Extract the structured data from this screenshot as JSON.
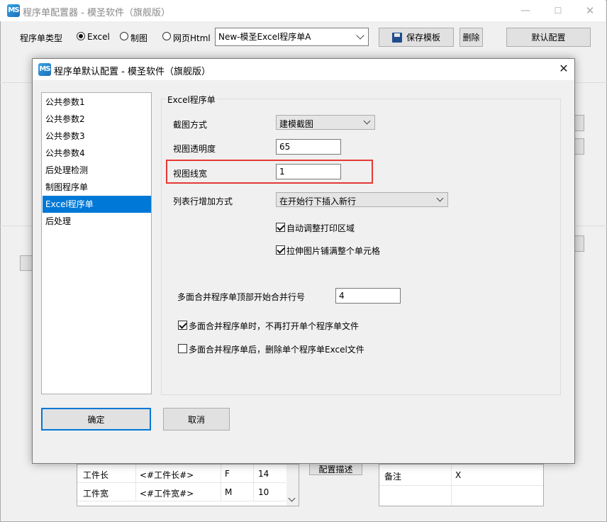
{
  "main_window": {
    "title": "程序单配置器 - 模圣软件（旗舰版）",
    "logo_text": "MS",
    "template_type_label": "程序单类型",
    "template_types": [
      {
        "label": "Excel",
        "selected": true
      },
      {
        "label": "制图",
        "selected": false
      },
      {
        "label": "网页Html",
        "selected": false
      }
    ],
    "template_select_value": "New-模圣Excel程序单A",
    "save_template_label": "保存模板",
    "delete_label": "删除",
    "default_config_label": "默认配置",
    "config_describe_label": "配置描述",
    "left_table_rows": [
      {
        "name": "工件长",
        "var": "<#工件长#>",
        "type": "F",
        "width": "14"
      },
      {
        "name": "工件宽",
        "var": "<#工件宽#>",
        "type": "M",
        "width": "10"
      }
    ],
    "right_table_rows": [
      {
        "name": "备注",
        "value": "X"
      }
    ]
  },
  "dialog": {
    "title": "程序单默认配置 - 模圣软件（旗舰版）",
    "nav_items": [
      "公共参数1",
      "公共参数2",
      "公共参数3",
      "公共参数4",
      "后处理检测",
      "制图程序单",
      "Excel程序单",
      "后处理"
    ],
    "selected_nav": "Excel程序单",
    "group_title": "Excel程序单",
    "screenshot_method_label": "截图方式",
    "screenshot_method_value": "建模截图",
    "view_transparency_label": "视图透明度",
    "view_transparency_value": "65",
    "view_linewidth_label": "视图线宽",
    "view_linewidth_value": "1",
    "list_row_add_label": "列表行增加方式",
    "list_row_add_value": "在开始行下插入新行",
    "auto_print_area_label": "自动调整打印区域",
    "auto_print_area_checked": true,
    "stretch_image_label": "拉伸图片铺满整个单元格",
    "stretch_image_checked": true,
    "merge_start_row_label": "多面合并程序单顶部开始合并行号",
    "merge_start_row_value": "4",
    "no_reopen_label": "多面合并程序单时，不再打开单个程序单文件",
    "no_reopen_checked": true,
    "delete_single_label": "多面合并程序单后，删除单个程序单Excel文件",
    "delete_single_checked": false,
    "ok_label": "确定",
    "cancel_label": "取消",
    "highlight_color": "#e53935",
    "selection_color": "#0078d7"
  }
}
